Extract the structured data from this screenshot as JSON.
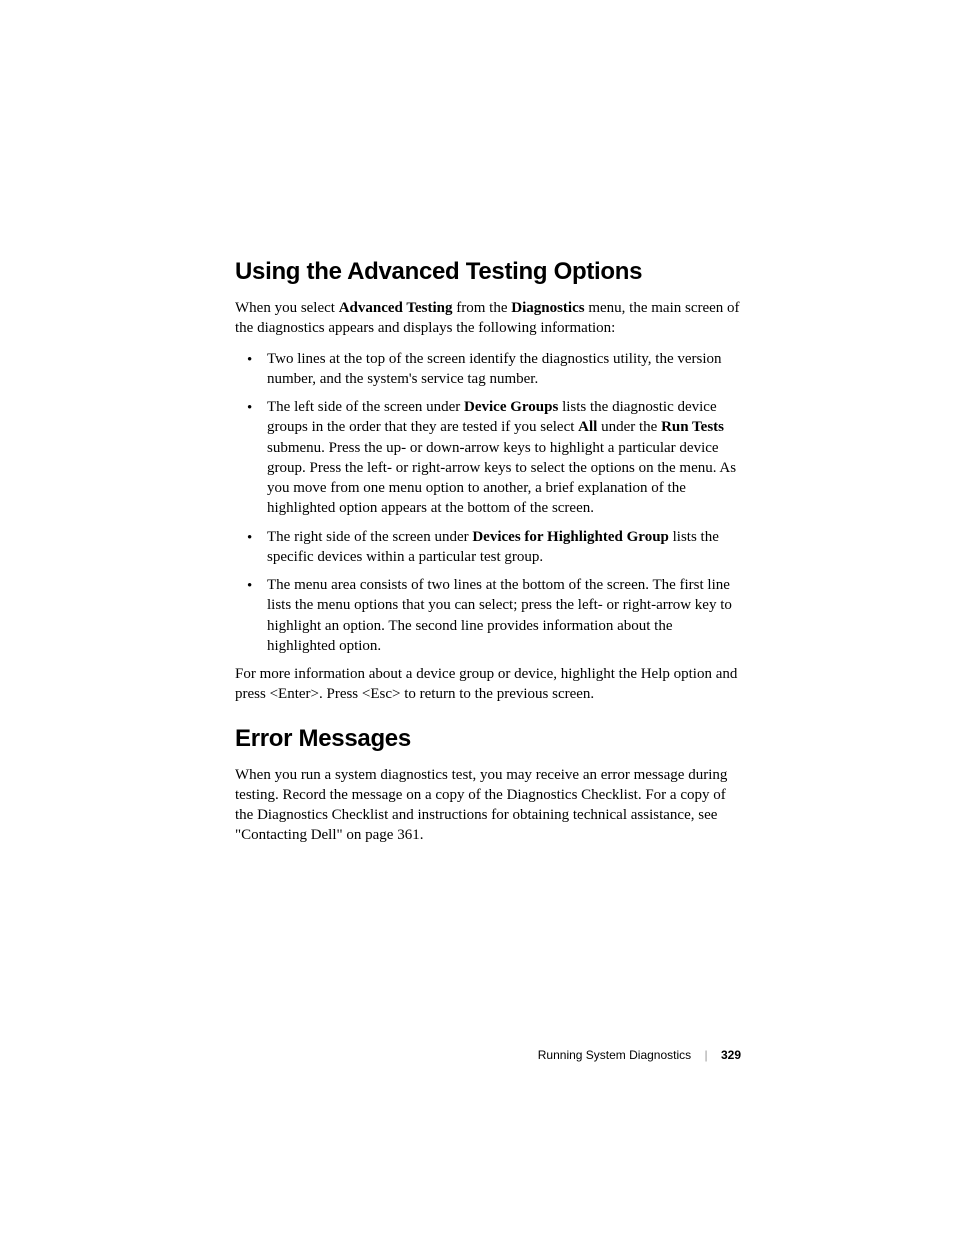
{
  "section1": {
    "heading": "Using the Advanced Testing Options",
    "intro_pre": "When you select ",
    "intro_b1": "Advanced Testing",
    "intro_mid": " from the ",
    "intro_b2": "Diagnostics",
    "intro_post": " menu, the main screen of the diagnostics appears and displays the following information:",
    "bullets": {
      "b1": "Two lines at the top of the screen identify the diagnostics utility, the version number, and the system's service tag number.",
      "b2_pre": "The left side of the screen under ",
      "b2_bold1": "Device Groups",
      "b2_mid1": " lists the diagnostic device groups in the order that they are tested if you select ",
      "b2_bold2": "All",
      "b2_mid2": " under the ",
      "b2_bold3": "Run Tests",
      "b2_post": " submenu. Press the up- or down-arrow keys to highlight a particular device group. Press the left- or right-arrow keys to select the options on the menu. As you move from one menu option to another, a brief explanation of the highlighted option appears at the bottom of the screen.",
      "b3_pre": "The right side of the screen under ",
      "b3_bold": "Devices for Highlighted Group",
      "b3_post": " lists the specific devices within a particular test group.",
      "b4": "The menu area consists of two lines at the bottom of the screen. The first line lists the menu options that you can select; press the left- or right-arrow key to highlight an option. The second line provides information about the highlighted option."
    },
    "outro": "For more information about a device group or device, highlight the Help option and press <Enter>. Press <Esc> to return to the previous screen."
  },
  "section2": {
    "heading": "Error Messages",
    "body": "When you run a system diagnostics test, you may receive an error message during testing. Record the message on a copy of the Diagnostics Checklist. For a copy of the Diagnostics Checklist and instructions for obtaining technical assistance, see \"Contacting Dell\" on page 361."
  },
  "footer": {
    "title": "Running System Diagnostics",
    "separator": "|",
    "page": "329"
  }
}
